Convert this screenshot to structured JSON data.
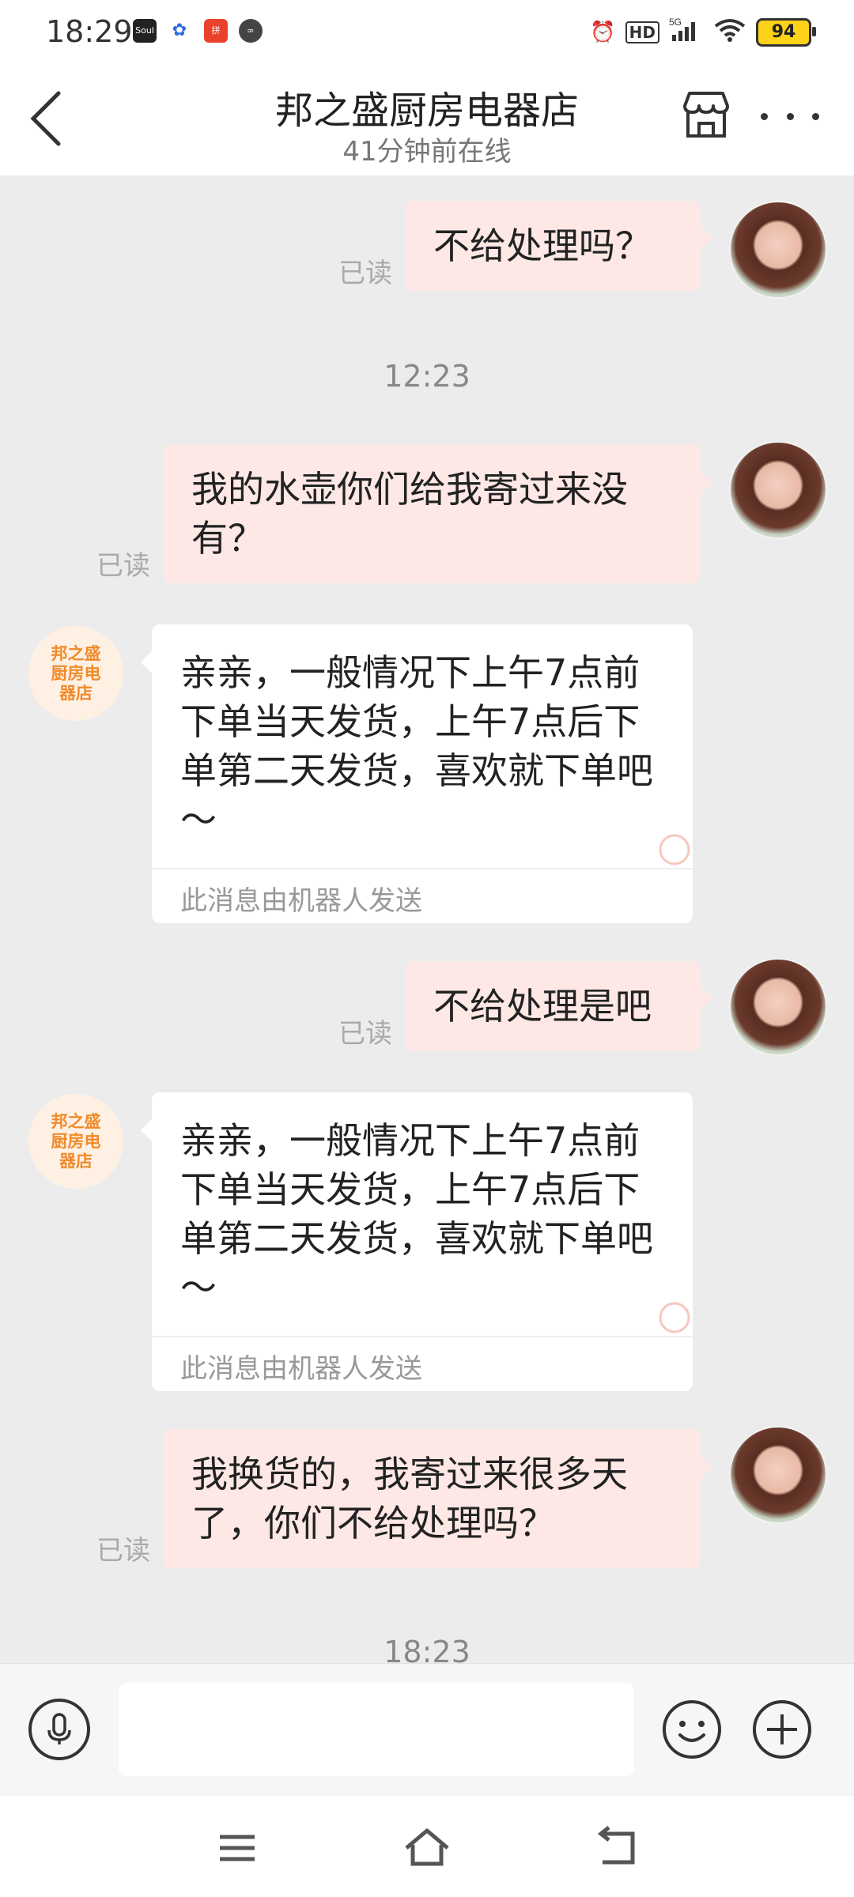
{
  "status_bar": {
    "time": "18:29",
    "apps": [
      "Soul",
      "baidu",
      "pdd",
      "link"
    ],
    "hd_label": "HD",
    "network": "5G",
    "battery": "94"
  },
  "header": {
    "title": "邦之盛厨房电器店",
    "subtitle": "41分钟前在线"
  },
  "shop_avatar_text": "邦之盛\n厨房电\n器店",
  "messages": [
    {
      "from": "me",
      "text": "不给处理吗？",
      "read": "已读"
    },
    {
      "type": "time",
      "text": "12:23"
    },
    {
      "from": "me",
      "text": "我的水壶你们给我寄过来没有？",
      "read": "已读"
    },
    {
      "from": "shop",
      "text": "亲亲，一般情况下上午7点前下单当天发货，上午7点后下单第二天发货，喜欢就下单吧～",
      "footer": "此消息由机器人发送"
    },
    {
      "from": "me",
      "text": "不给处理是吧",
      "read": "已读"
    },
    {
      "from": "shop",
      "text": "亲亲，一般情况下上午7点前下单当天发货，上午7点后下单第二天发货，喜欢就下单吧～",
      "footer": "此消息由机器人发送"
    },
    {
      "from": "me",
      "text": "我换货的，我寄过来很多天了，你们不给处理吗？",
      "read": "已读"
    },
    {
      "type": "time",
      "text": "18:23"
    }
  ],
  "input": {
    "placeholder": ""
  },
  "colors": {
    "my_bubble": "#fde8e5",
    "shop_accent": "#f08a2a",
    "battery": "#ffd21a"
  }
}
